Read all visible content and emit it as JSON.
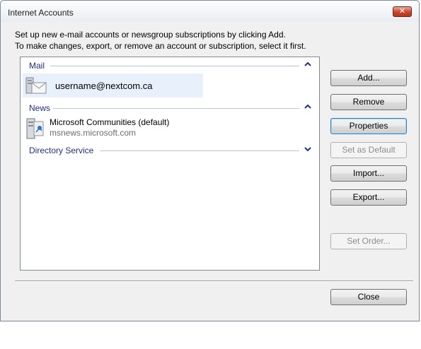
{
  "window": {
    "title": "Internet Accounts",
    "close_glyph": "✕"
  },
  "instructions": {
    "line1": "Set up new e-mail accounts or newsgroup subscriptions by clicking Add.",
    "line2": "To make changes, export, or remove an account or subscription, select it first."
  },
  "groups": {
    "mail": {
      "label": "Mail",
      "state": "expanded",
      "items": [
        {
          "name": "username@nextcom.ca",
          "icon": "mail-account-icon"
        }
      ]
    },
    "news": {
      "label": "News",
      "state": "expanded",
      "items": [
        {
          "name": "Microsoft Communities (default)",
          "server": "msnews.microsoft.com",
          "icon": "news-server-icon"
        }
      ]
    },
    "directory": {
      "label": "Directory Service",
      "state": "collapsed"
    }
  },
  "buttons": {
    "add": "Add...",
    "remove": "Remove",
    "properties": "Properties",
    "set_default": "Set as Default",
    "import": "Import...",
    "export": "Export...",
    "set_order": "Set Order...",
    "close": "Close"
  },
  "colors": {
    "group_header": "#1e3287",
    "selection": "#e8f1fb",
    "close_button": "#c7442b"
  }
}
